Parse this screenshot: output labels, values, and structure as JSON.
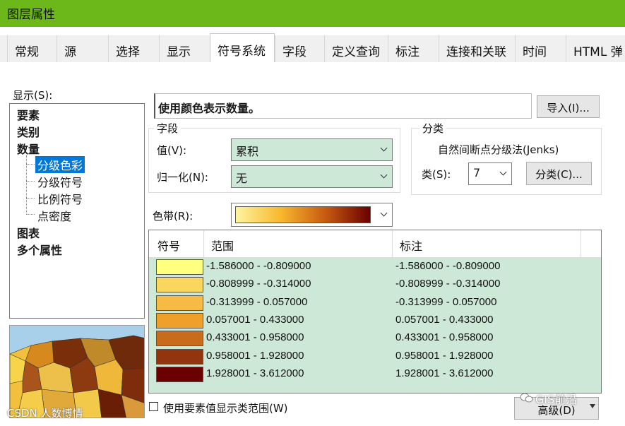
{
  "window": {
    "title": "图层属性"
  },
  "tabs": [
    {
      "label": "常规"
    },
    {
      "label": "源"
    },
    {
      "label": "选择"
    },
    {
      "label": "显示"
    },
    {
      "label": "符号系统"
    },
    {
      "label": "字段"
    },
    {
      "label": "定义查询"
    },
    {
      "label": "标注"
    },
    {
      "label": "连接和关联"
    },
    {
      "label": "时间"
    },
    {
      "label": "HTML 弹"
    }
  ],
  "show": {
    "label": "显示(S):",
    "items": [
      {
        "label": "要素"
      },
      {
        "label": "类别"
      },
      {
        "label": "数量"
      },
      {
        "label": "分级色彩"
      },
      {
        "label": "分级符号"
      },
      {
        "label": "比例符号"
      },
      {
        "label": "点密度"
      },
      {
        "label": "图表"
      },
      {
        "label": "多个属性"
      }
    ]
  },
  "description": "使用颜色表示数量。",
  "import_button": "导入(I)...",
  "fields": {
    "group_title": "字段",
    "value_label": "值(V):",
    "value": "累积",
    "normalization_label": "归一化(N):",
    "normalization": "无"
  },
  "classification": {
    "group_title": "分类",
    "method": "自然间断点分级法(Jenks)",
    "classes_label": "类(S):",
    "classes_value": "7",
    "classify_button": "分类(C)..."
  },
  "color_ramp": {
    "label": "色带(R):",
    "colors": [
      "#fff4a0",
      "#f7b92d",
      "#c85a10",
      "#6b0000"
    ]
  },
  "table": {
    "headers": [
      "符号",
      "范围",
      "标注"
    ],
    "rows": [
      {
        "color": "#ffff80",
        "range": "-1.586000 - -0.809000",
        "label": "-1.586000 - -0.809000"
      },
      {
        "color": "#fbd65e",
        "range": "-0.808999 - -0.314000",
        "label": "-0.808999 - -0.314000"
      },
      {
        "color": "#f5bb45",
        "range": "-0.313999 - 0.057000",
        "label": "-0.313999 - 0.057000"
      },
      {
        "color": "#eea02a",
        "range": "0.057001 - 0.433000",
        "label": "0.057001 - 0.433000"
      },
      {
        "color": "#c96b1b",
        "range": "0.433001 - 0.958000",
        "label": "0.433001 - 0.958000"
      },
      {
        "color": "#92350f",
        "range": "0.958001 - 1.928000",
        "label": "0.958001 - 1.928000"
      },
      {
        "color": "#6b0000",
        "range": "1.928001 - 3.612000",
        "label": "1.928001 - 3.612000"
      }
    ]
  },
  "show_feature_ranges": {
    "label": "使用要素值显示类范围(W)",
    "checked": false
  },
  "advanced_button": "高级(D)",
  "watermark": {
    "text": "GIS前沿",
    "icon": "wechat-icon"
  },
  "watermark2": {
    "text": "CSDN 人数博情"
  }
}
